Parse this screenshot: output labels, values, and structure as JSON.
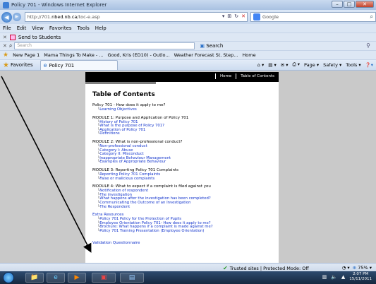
{
  "window": {
    "title": "Policy 701 - Windows Internet Explorer"
  },
  "address": {
    "url_prefix": "http://701.",
    "url_host": "nbed.nb.ca",
    "url_path": "/toc-e.asp"
  },
  "search_box": {
    "label": "Google"
  },
  "menu": [
    "File",
    "Edit",
    "View",
    "Favorites",
    "Tools",
    "Help"
  ],
  "send_bar": {
    "label": "Send to Students"
  },
  "search_toolbar": {
    "placeholder": "Search",
    "search_btn": "Search"
  },
  "favorites_bar": {
    "items": [
      "New Page 1",
      "Mama Things To Make - ...",
      "Good, Kris (ED10) - Outlo...",
      "Weather Forecast St. Step...",
      "Home"
    ]
  },
  "tabbar": {
    "favorites_label": "Favorites",
    "tab_label": "Policy 701",
    "commands": [
      "Page",
      "Safety",
      "Tools"
    ]
  },
  "page": {
    "nav": [
      "Home",
      "Table of Contents"
    ],
    "heading": "Table of Contents",
    "sections": [
      {
        "title": "Policy 701 - How does it apply to me?",
        "links": [
          "Learning Objectives"
        ]
      },
      {
        "title": "MODULE 1: Purpose and Application of Policy 701",
        "links": [
          "History of Policy 701",
          "What is the purpose of Policy 701?",
          "Application of Policy 701",
          "Definitions"
        ]
      },
      {
        "title": "MODULE 2: What is non-professional conduct?",
        "links": [
          "Non-professional conduct",
          "Category I: Abuse",
          "Category II: Misconduct",
          "Inappropriate Behaviour Management",
          "Examples of Appropriate Behaviour"
        ]
      },
      {
        "title": "MODULE 3: Reporting Policy 701 Complaints",
        "links": [
          "Reporting Policy 701 Complaints",
          "False or malicious complaints"
        ]
      },
      {
        "title": "MODULE 4: What to expect if a complaint is filed against you",
        "links": [
          "Notification of respondent",
          "The investigation",
          "What happens after the investigation has been completed?",
          "Communicating the Outcome of an Investigation",
          "The Respondent"
        ]
      },
      {
        "title": "Extra Resources",
        "title_link": true,
        "links": [
          "Policy 701 Policy for the Protection of Pupils",
          "Employee Orientation Policy 701- How does it apply to me?",
          "Brochure: What happens if a complaint is made against me?",
          "Policy 701 Training Presentation (Employee Orientation)"
        ]
      }
    ],
    "questionnaire": "Validation Questionnaire"
  },
  "status": {
    "trusted": "Trusted sites | Protected Mode: Off",
    "zoom": "75%"
  },
  "taskbar": {
    "time": "2:07 PM",
    "date": "15/11/2011"
  },
  "colors": {
    "link": "#1133cc",
    "page_bar": "#000000"
  }
}
